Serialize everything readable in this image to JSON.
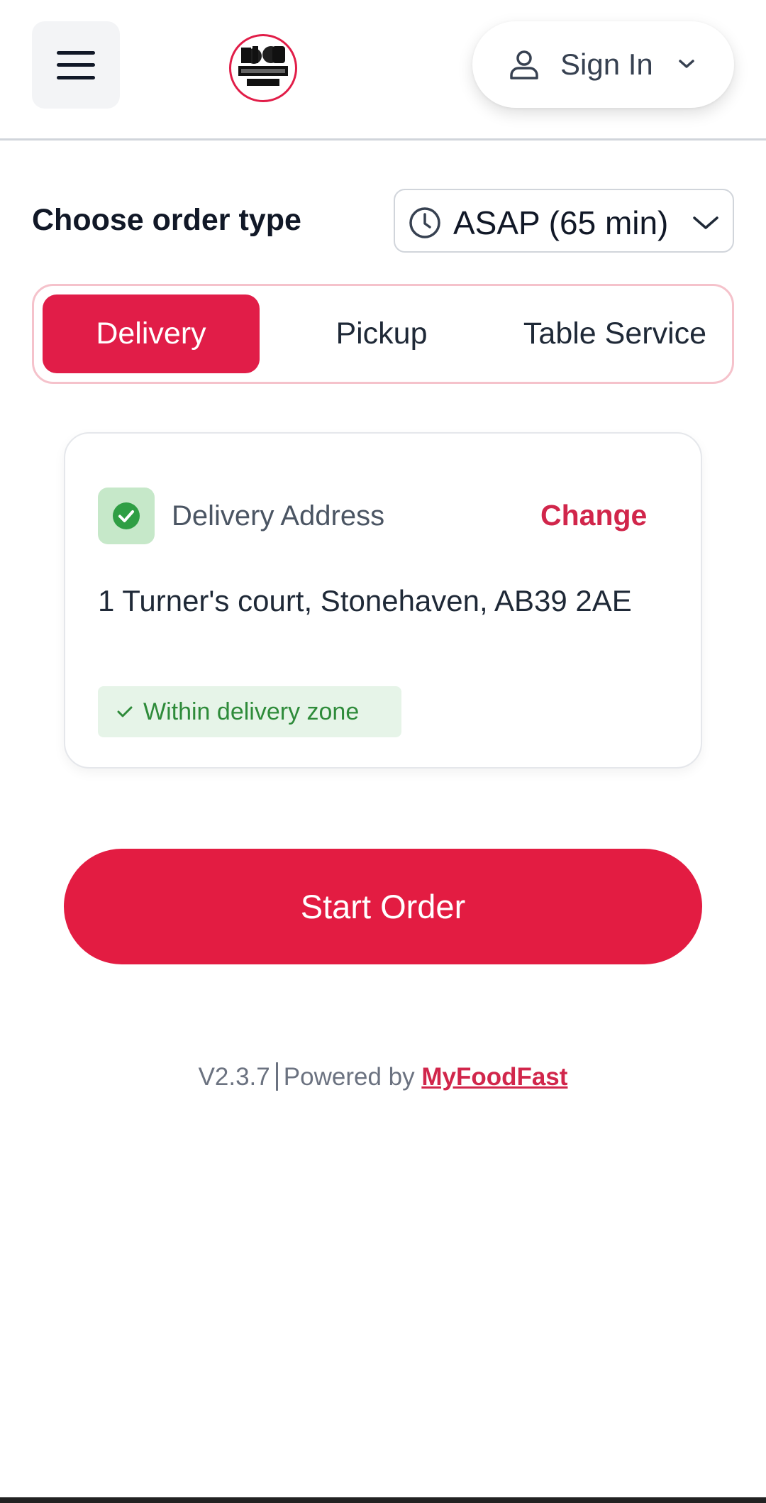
{
  "header": {
    "menu_icon": "hamburger-menu-icon",
    "logo_text": "BIG MANNY'S PIZZA",
    "signin": {
      "label": "Sign In",
      "icon": "user-icon",
      "chevron": "chevron-down-icon"
    }
  },
  "order": {
    "label": "Choose order type",
    "time_select": {
      "value": "ASAP (65 min)",
      "icon": "clock-icon"
    },
    "tabs": [
      {
        "label": "Delivery",
        "active": true
      },
      {
        "label": "Pickup",
        "active": false
      },
      {
        "label": "Table Service",
        "active": false
      }
    ]
  },
  "address_card": {
    "title": "Delivery Address",
    "change_label": "Change",
    "address": "1 Turner's court, Stonehaven, AB39 2AE",
    "zone_badge": "Within delivery zone"
  },
  "start_button": "Start Order",
  "footer": {
    "version": "V2.3.7",
    "powered_by": "Powered by",
    "brand_link": "MyFoodFast"
  },
  "colors": {
    "accent": "#e31c42",
    "success": "#2e8b3a",
    "success_bg": "#e6f4e8"
  }
}
